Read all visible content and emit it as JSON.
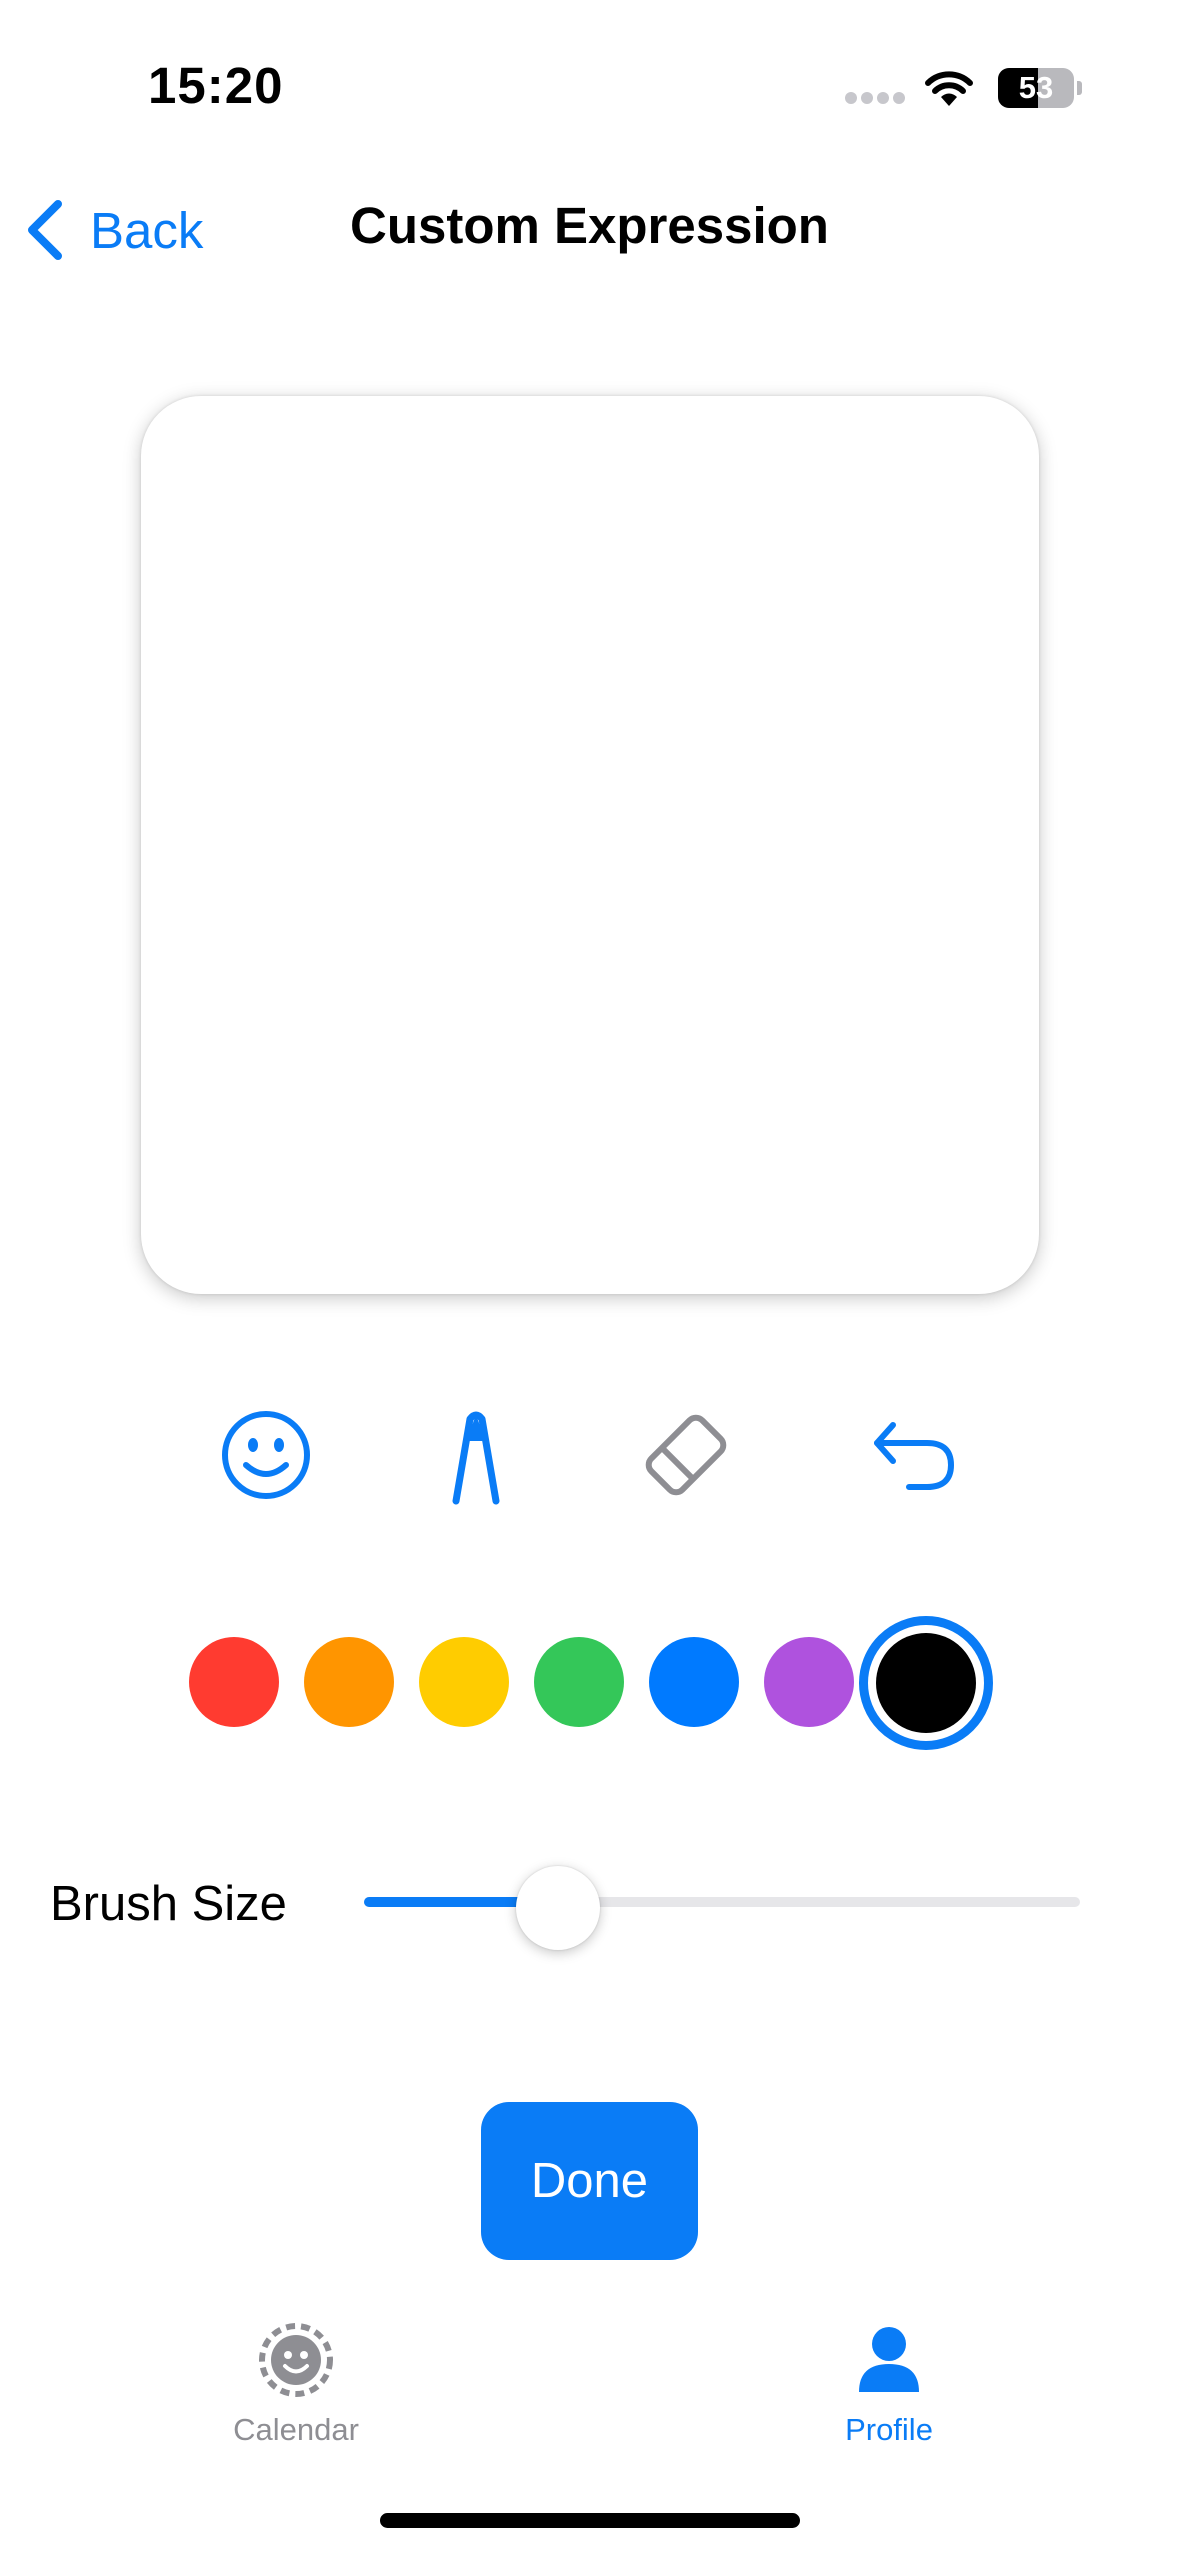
{
  "status_bar": {
    "time": "15:20",
    "battery_level": "53",
    "battery_fraction": 0.53
  },
  "nav": {
    "back_label": "Back",
    "title": "Custom Expression"
  },
  "canvas": {
    "drawn_content": "empty"
  },
  "tools": [
    {
      "name": "emoji",
      "icon": "smiley-face-icon",
      "color": "#0A7CF6"
    },
    {
      "name": "pen",
      "icon": "pen-tip-icon",
      "color": "#0A7CF6"
    },
    {
      "name": "eraser",
      "icon": "eraser-icon",
      "color": "#8E8E93"
    },
    {
      "name": "undo",
      "icon": "undo-arrow-icon",
      "color": "#0A7CF6"
    }
  ],
  "colors": {
    "options": [
      "#FF3B30",
      "#FF9500",
      "#FFCC00",
      "#34C759",
      "#007AFF",
      "#AF52DE",
      "#000000"
    ],
    "selected": "#000000"
  },
  "brush": {
    "label": "Brush Size",
    "value_fraction": 0.24
  },
  "done_button": {
    "label": "Done"
  },
  "tab_bar": {
    "tabs": [
      {
        "label": "Calendar",
        "icon": "dashed-smiley-icon",
        "active": false
      },
      {
        "label": "Profile",
        "icon": "person-icon",
        "active": true
      }
    ],
    "active_color": "#0A7CF6",
    "inactive_color": "#8E8E93"
  }
}
